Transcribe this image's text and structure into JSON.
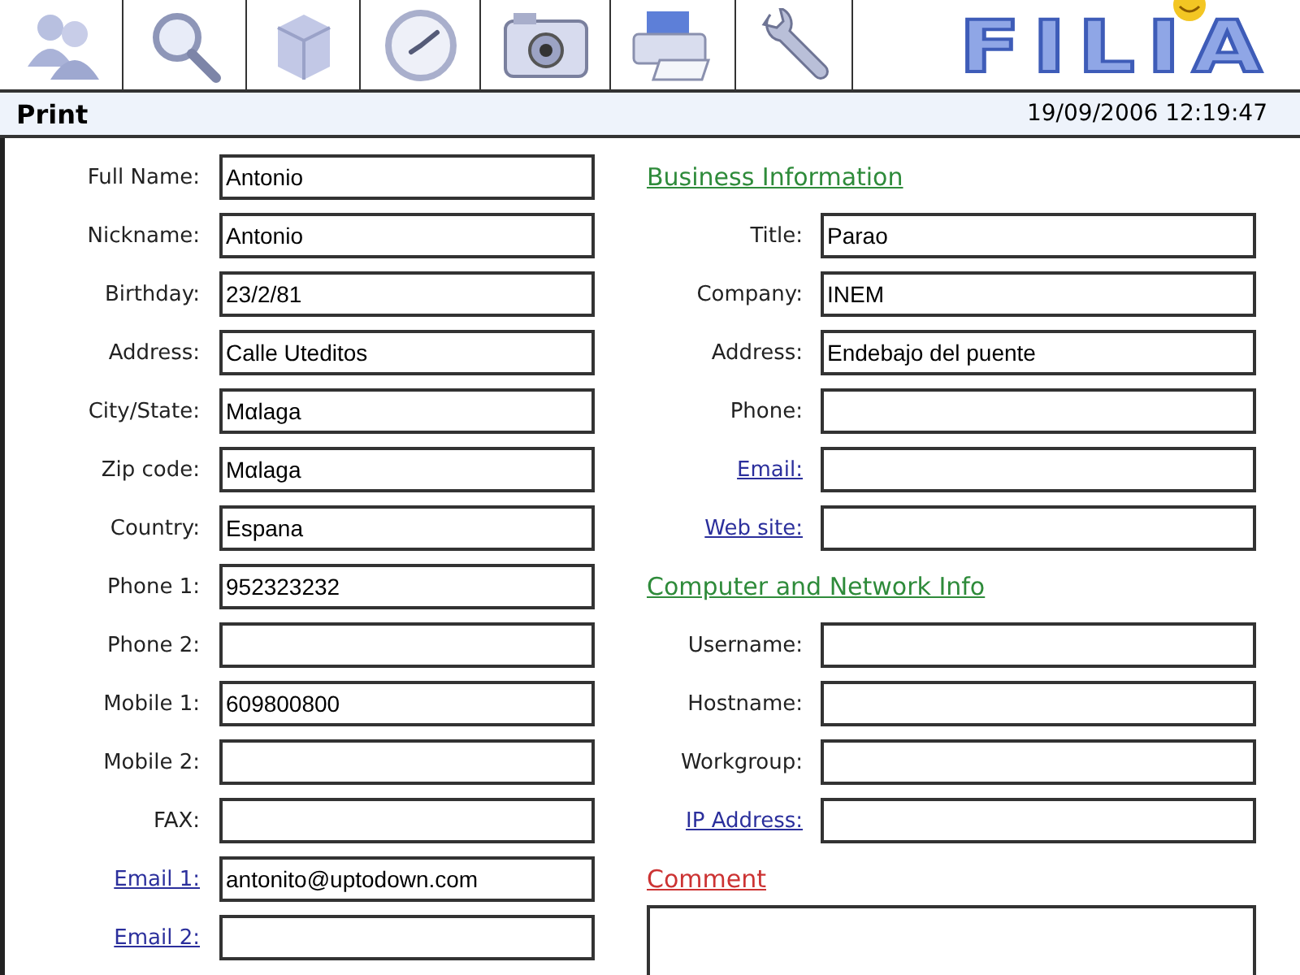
{
  "toolbar": {
    "tools": [
      {
        "kind": "people"
      },
      {
        "kind": "search"
      },
      {
        "kind": "box"
      },
      {
        "kind": "clock"
      },
      {
        "kind": "camera"
      },
      {
        "kind": "printer"
      },
      {
        "kind": "wrench"
      }
    ],
    "logo": "FILIA"
  },
  "header": {
    "title": "Print",
    "datetime": "19/09/2006 12:19:47"
  },
  "personal": [
    {
      "label": "Full Name:",
      "kind": "plain",
      "value": "Antonio"
    },
    {
      "label": "Nickname:",
      "kind": "plain",
      "value": "Antonio"
    },
    {
      "label": "Birthday:",
      "kind": "plain",
      "value": "23/2/81"
    },
    {
      "label": "Address:",
      "kind": "plain",
      "value": "Calle Uteditos"
    },
    {
      "label": "City/State:",
      "kind": "plain",
      "value": "Mαlaga"
    },
    {
      "label": "Zip code:",
      "kind": "plain",
      "value": "Mαlaga"
    },
    {
      "label": "Country:",
      "kind": "plain",
      "value": "Espana"
    },
    {
      "label": "Phone 1:",
      "kind": "plain",
      "value": "952323232"
    },
    {
      "label": "Phone 2:",
      "kind": "plain"
    },
    {
      "label": "Mobile 1:",
      "kind": "plain",
      "value": "609800800"
    },
    {
      "label": "Mobile 2:",
      "kind": "plain"
    },
    {
      "label": "FAX:",
      "kind": "plain"
    },
    {
      "label": "Email 1:",
      "kind": "link",
      "value": "antonito@uptodown.com"
    },
    {
      "label": "Email 2:",
      "kind": "link"
    }
  ],
  "sections": [
    {
      "heading": "Business Information",
      "color": "#2e8b3a",
      "fields": [
        {
          "label": "Title:",
          "kind": "plain",
          "value": "Parao"
        },
        {
          "label": "Company:",
          "kind": "plain",
          "value": "INEM"
        },
        {
          "label": "Address:",
          "kind": "plain",
          "value": "Endebajo del puente"
        },
        {
          "label": "Phone:",
          "kind": "plain"
        },
        {
          "label": "Email:",
          "kind": "link"
        },
        {
          "label": "Web site:",
          "kind": "link"
        }
      ]
    },
    {
      "heading": "Computer and Network Info",
      "color": "#2e8b3a",
      "fields": [
        {
          "label": "Username:",
          "kind": "plain"
        },
        {
          "label": "Hostname:",
          "kind": "plain"
        },
        {
          "label": "Workgroup:",
          "kind": "plain"
        },
        {
          "label": "IP Address:",
          "kind": "link"
        }
      ]
    },
    {
      "heading": "Comment",
      "color": "#cc3333",
      "fields": [
        {
          "kind": "textarea"
        }
      ]
    }
  ]
}
